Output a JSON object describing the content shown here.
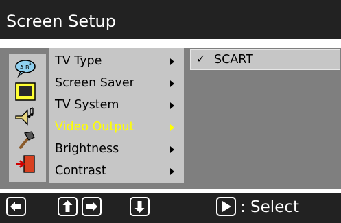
{
  "title": "Screen Setup",
  "menu": {
    "items": [
      {
        "label": "TV Type"
      },
      {
        "label": "Screen Saver"
      },
      {
        "label": "TV System"
      },
      {
        "label": "Video Output"
      },
      {
        "label": "Brightness"
      },
      {
        "label": "Contrast"
      }
    ],
    "selected_index": 3
  },
  "submenu": {
    "items": [
      {
        "check": "✓",
        "label": "SCART"
      }
    ]
  },
  "sidebar_icons": [
    "language-icon",
    "display-icon",
    "audio-icon",
    "tools-icon",
    "exit-icon"
  ],
  "footer": {
    "buttons": [
      "left-arrow-icon",
      "up-arrow-icon",
      "right-arrow-icon",
      "down-arrow-icon",
      "play-icon"
    ],
    "select_label": ": Select"
  },
  "colors": {
    "title_bg": "#222222",
    "panel_bg": "#7f7f7f",
    "menu_bg": "#c6c6c6",
    "highlight_text": "#ffff00"
  }
}
